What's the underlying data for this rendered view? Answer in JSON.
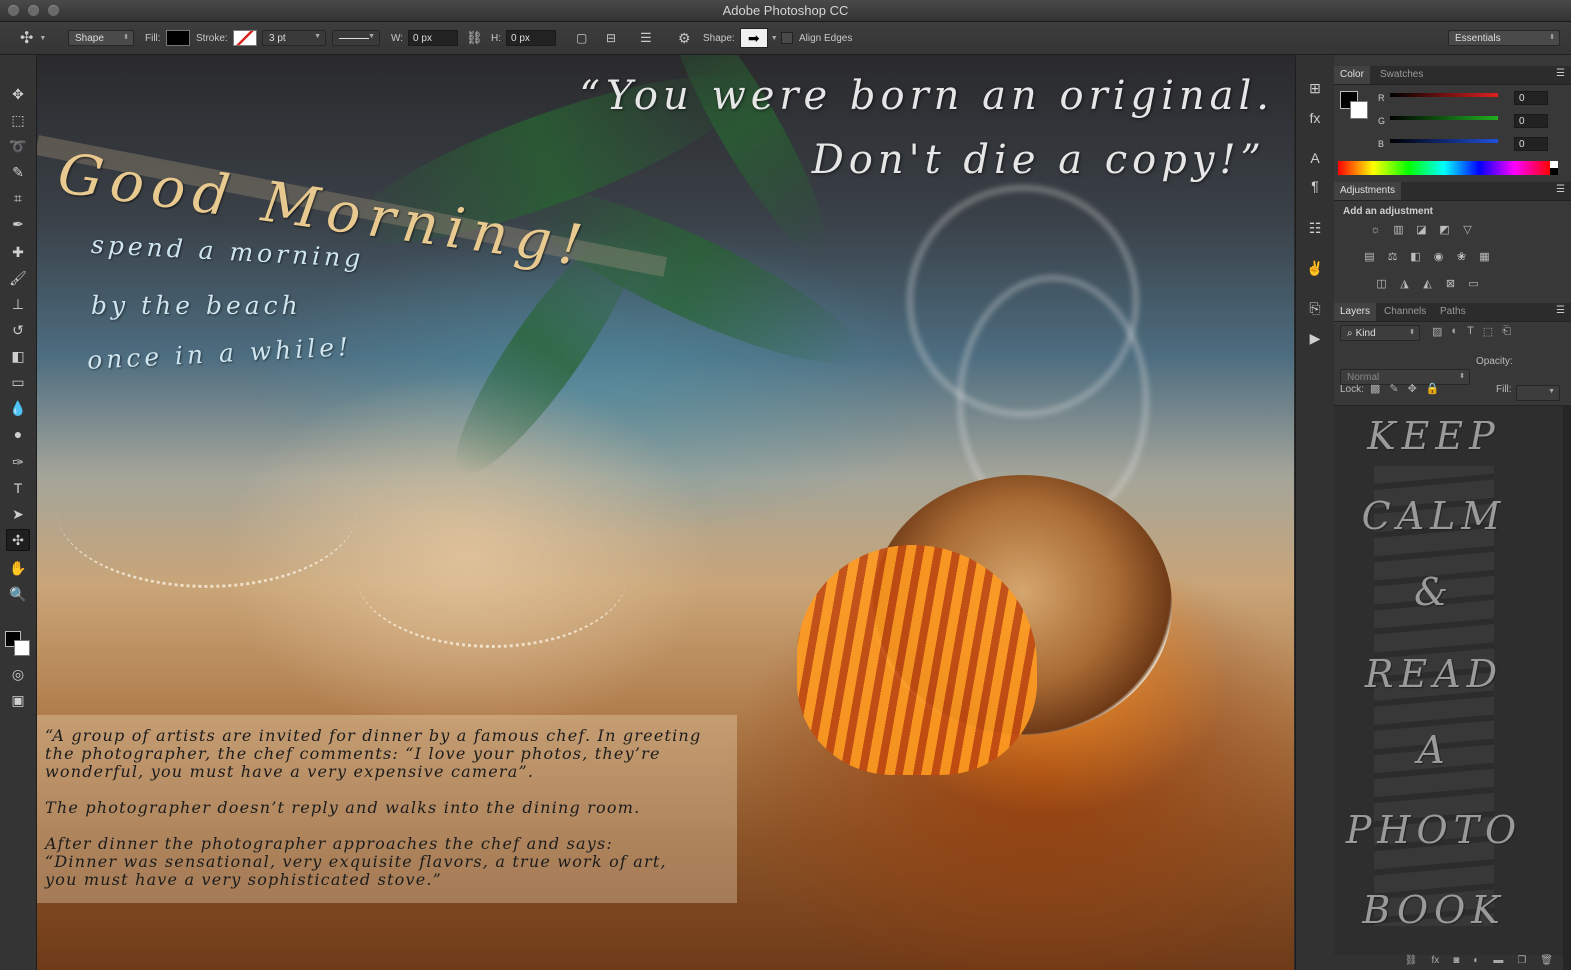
{
  "app": {
    "title": "Adobe Photoshop CC"
  },
  "options_bar": {
    "tool_mode": "Shape",
    "fill_label": "Fill:",
    "stroke_label": "Stroke:",
    "stroke_width": "3 pt",
    "w_label": "W:",
    "w_value": "0 px",
    "h_label": "H:",
    "h_value": "0 px",
    "shape_label": "Shape:",
    "align_edges_label": "Align Edges",
    "workspace": "Essentials",
    "fill_color": "#000000",
    "stroke_color": "#cc2222"
  },
  "canvas": {
    "good_morning": "Good Morning!",
    "spend_lines": [
      "spend a morning",
      "by the beach",
      "once in a while!"
    ],
    "quote_line1": "“You were born an original.",
    "quote_line2": "Don't die a copy!”",
    "story_paragraphs": [
      "“A group of artists are invited for dinner by a famous chef. In greeting\nthe photographer, the chef comments: “I love your photos, they’re\nwonderful, you must have a very expensive camera”.",
      "The photographer doesn’t reply and walks into the dining room.",
      "After dinner the photographer approaches the chef and says:\n“Dinner was sensational, very exquisite flavors, a true work of art,\nyou must have a very sophisticated stove.”"
    ]
  },
  "color_panel": {
    "tabs": [
      "Color",
      "Swatches"
    ],
    "channels": [
      {
        "label": "R",
        "value": "0",
        "color": "#e02020"
      },
      {
        "label": "G",
        "value": "0",
        "color": "#20b020"
      },
      {
        "label": "B",
        "value": "0",
        "color": "#2050e0"
      }
    ]
  },
  "adjustments_panel": {
    "tab": "Adjustments",
    "heading": "Add an adjustment"
  },
  "layers_panel": {
    "tabs": [
      "Layers",
      "Channels",
      "Paths"
    ],
    "kind_filter": "Kind",
    "blend_mode": "Normal",
    "opacity_label": "Opacity:",
    "lock_label": "Lock:",
    "fill_label": "Fill:",
    "thumbnail_words": [
      "KEEP",
      "CALM",
      "&",
      "READ",
      "A",
      "PHOTO",
      "BOOK"
    ]
  }
}
